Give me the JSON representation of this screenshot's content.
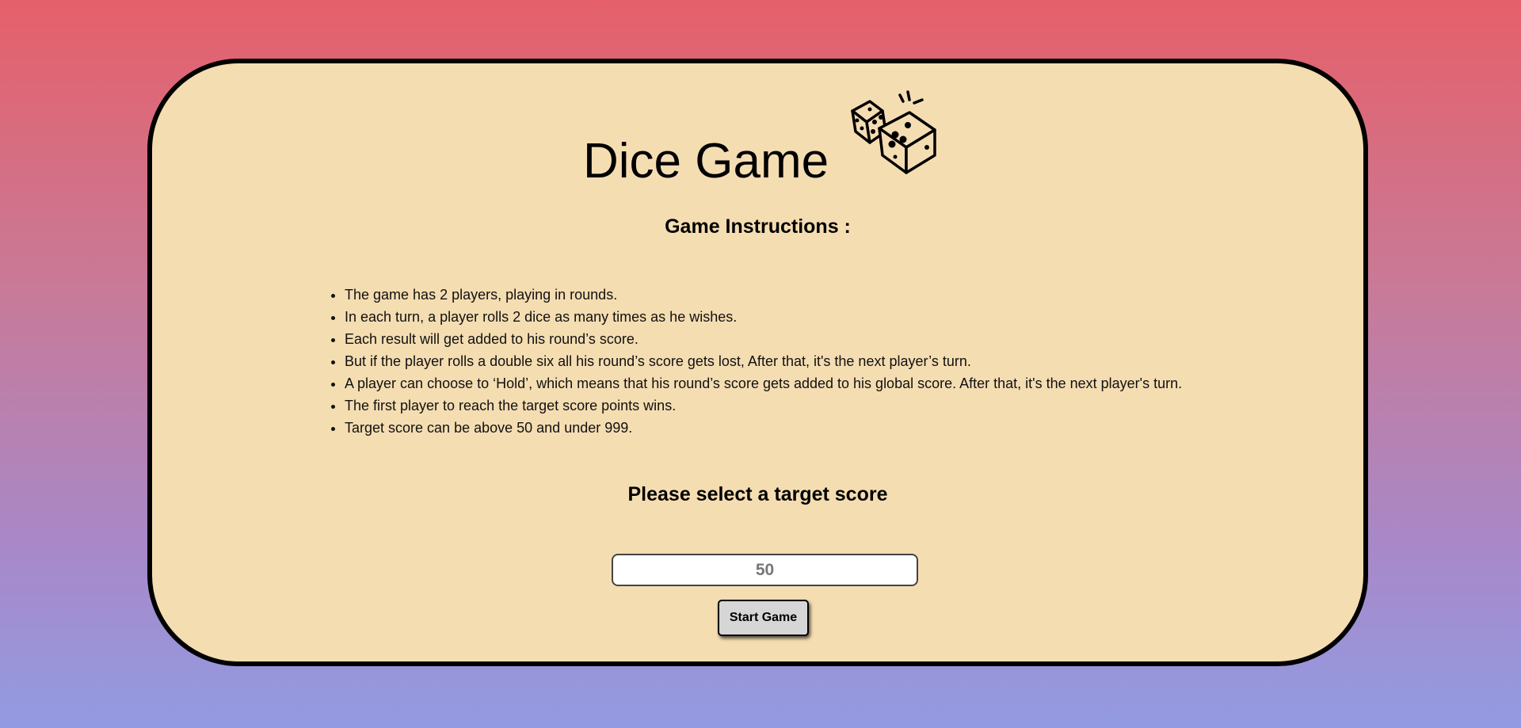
{
  "page": {
    "title": "Dice Game",
    "logo_icon": "dice-icon"
  },
  "instructions": {
    "heading": "Game Instructions :",
    "rules": [
      "The game has 2 players, playing in rounds.",
      "In each turn, a player rolls 2 dice as many times as he wishes.",
      "Each result will get added to his round’s score.",
      "But if the player rolls a double six all his round’s score gets lost, After that, it's the next player’s turn.",
      "A player can choose to ‘Hold’, which means that his round’s score gets added to his global score. After that, it's the next player's turn.",
      "The first player to reach the target score points wins.",
      "Target score can be above 50 and under 999."
    ]
  },
  "target": {
    "heading": "Please select a target score",
    "input_placeholder": "50",
    "input_value": ""
  },
  "actions": {
    "start_label": "Start Game"
  },
  "colors": {
    "card_background": "#f5ddb2",
    "gradient_top": "#e6606a",
    "gradient_bottom": "#929be2"
  }
}
